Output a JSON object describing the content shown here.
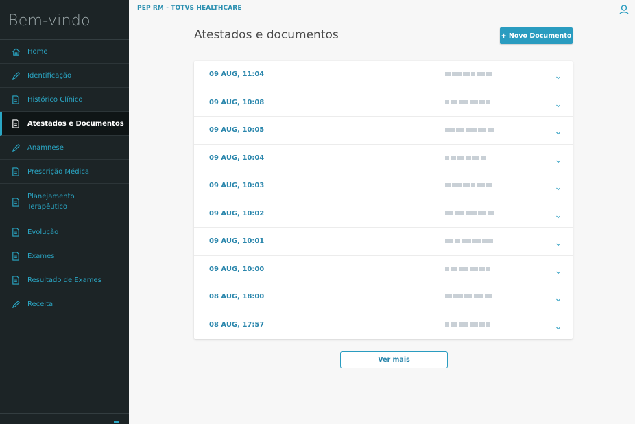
{
  "sidebar": {
    "title": "Bem-vindo",
    "items": [
      {
        "label": "Home",
        "icon": "home-icon"
      },
      {
        "label": "Identificação",
        "icon": "pencil-icon"
      },
      {
        "label": "Histórico Clínico",
        "icon": "document-icon"
      },
      {
        "label": "Atestados e Documentos",
        "icon": "document-icon",
        "active": true
      },
      {
        "label": "Anamnese",
        "icon": "pencil-icon"
      },
      {
        "label": "Prescrição Médica",
        "icon": "document-icon"
      },
      {
        "label": "Planejamento Terapêutico",
        "icon": "document-icon"
      },
      {
        "label": "Evolução",
        "icon": "document-icon"
      },
      {
        "label": "Exames",
        "icon": "document-icon"
      },
      {
        "label": "Resultado de Exames",
        "icon": "document-icon"
      },
      {
        "label": "Receita",
        "icon": "pencil-icon"
      }
    ]
  },
  "header": {
    "app_title": "PEP RM - TOTVS HEALTHCARE"
  },
  "main": {
    "title": "Atestados e documentos",
    "new_document_label": "+ Novo Documento",
    "documents": [
      {
        "date": "09 AUG, 11:04"
      },
      {
        "date": "09 AUG, 10:08"
      },
      {
        "date": "09 AUG, 10:05"
      },
      {
        "date": "09 AUG, 10:04"
      },
      {
        "date": "09 AUG, 10:03"
      },
      {
        "date": "09 AUG, 10:02"
      },
      {
        "date": "09 AUG, 10:01"
      },
      {
        "date": "09 AUG, 10:00"
      },
      {
        "date": "08 AUG, 18:00"
      },
      {
        "date": "08 AUG, 17:57"
      }
    ],
    "more_label": "Ver mais"
  },
  "colors": {
    "accent": "#2a9cc0",
    "sidebar_bg": "#1c2426",
    "sidebar_active_bg": "#0f1516",
    "page_bg": "#f7f7f7"
  }
}
